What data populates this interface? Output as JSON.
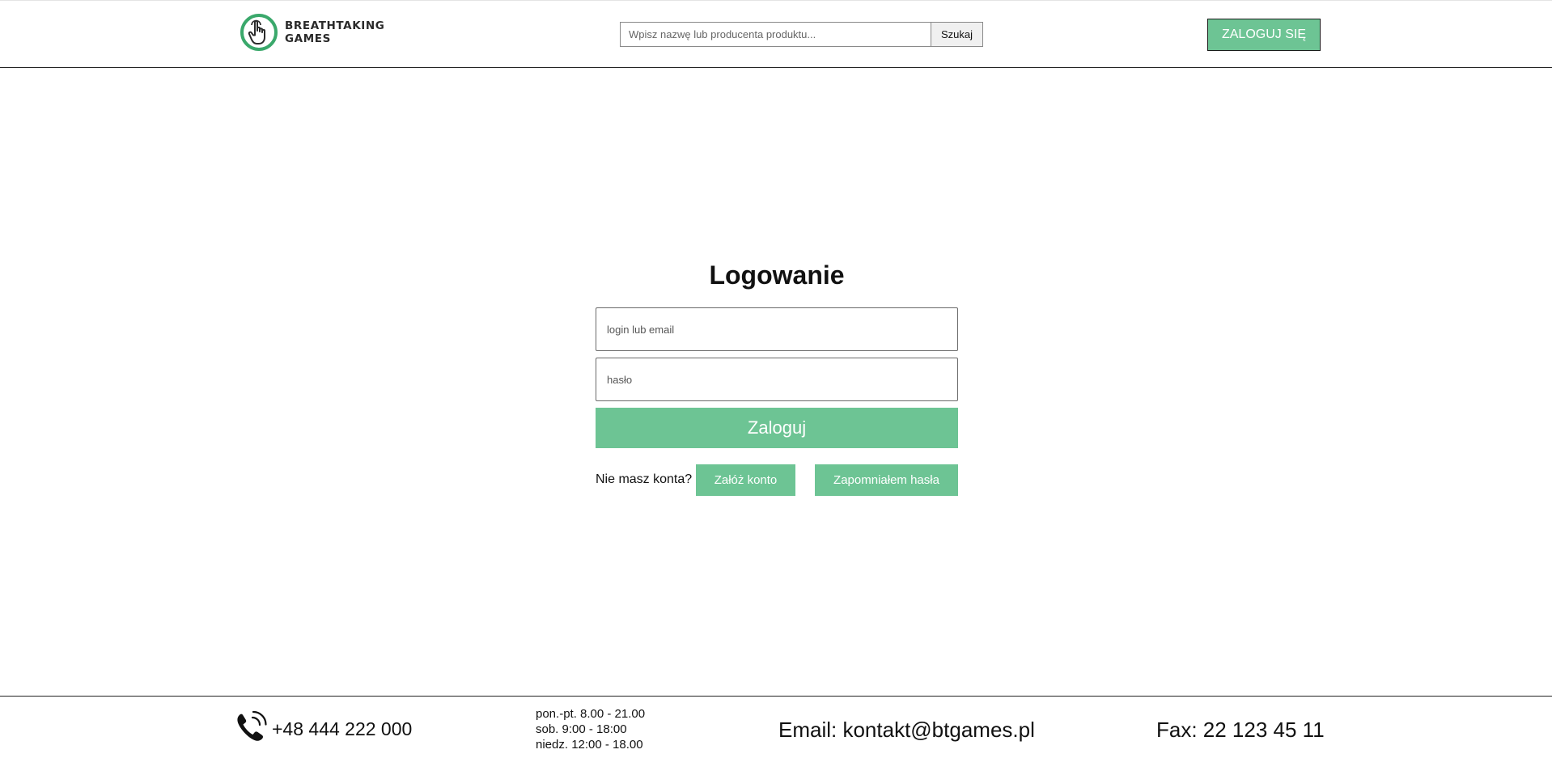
{
  "header": {
    "logo": {
      "line1": "BREATHTAKING",
      "line2": "GAMES",
      "icon": "hand-pointer-icon",
      "brand_color": "#3aa86b"
    },
    "search": {
      "placeholder": "Wpisz nazwę lub producenta produktu...",
      "button_label": "Szukaj"
    },
    "login_button_label": "ZALOGUJ SIĘ"
  },
  "login_form": {
    "title": "Logowanie",
    "login_placeholder": "login lub email",
    "password_placeholder": "hasło",
    "submit_label": "Zaloguj",
    "no_account_text": "Nie masz konta?",
    "register_label": "Załóż konto",
    "forgot_label": "Zapomniałem hasła"
  },
  "footer": {
    "phone_icon": "phone-icon",
    "phone": "+48 444 222 000",
    "hours": [
      "pon.-pt. 8.00 - 21.00",
      "sob. 9:00 - 18:00",
      "niedz. 12:00 - 18.00"
    ],
    "email": "Email: kontakt@btgames.pl",
    "fax": "Fax: 22 123 45 11"
  },
  "colors": {
    "accent": "#6dc494",
    "border": "#222222"
  }
}
